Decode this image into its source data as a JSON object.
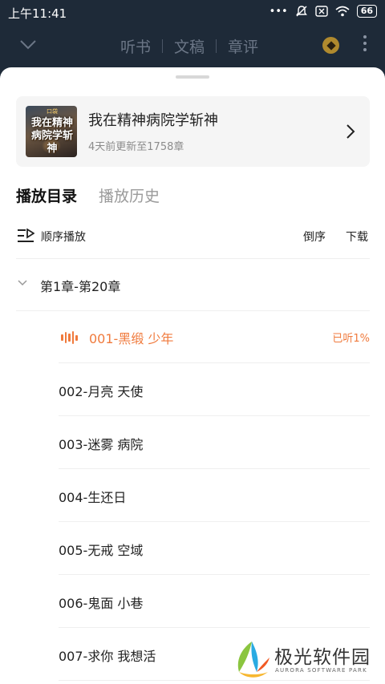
{
  "status_bar": {
    "time": "上午11:41",
    "signal_dots": "•••",
    "battery": "66"
  },
  "top_nav": {
    "tabs": [
      "听书",
      "文稿",
      "章评"
    ]
  },
  "book": {
    "title": "我在精神病院学斩神",
    "subtitle": "4天前更新至1758章",
    "cover_text": "我在精神病院学斩神",
    "cover_badge": "口袋"
  },
  "tabs": {
    "active": "播放目录",
    "inactive": "播放历史"
  },
  "toolbar": {
    "order_label": "顺序播放",
    "reverse_label": "倒序",
    "download_label": "下载"
  },
  "group": {
    "label": "第1章-第20章"
  },
  "chapters": [
    {
      "title": "001-黑缎 少年",
      "progress": "已听1%",
      "active": true
    },
    {
      "title": "002-月亮 天使"
    },
    {
      "title": "003-迷雾 病院"
    },
    {
      "title": "004-生还日"
    },
    {
      "title": "005-无戒 空域"
    },
    {
      "title": "006-鬼面 小巷"
    },
    {
      "title": "007-求你 我想活"
    }
  ],
  "watermark": {
    "name": "极光软件园",
    "sub": "AURORA SOFTWARE PARK"
  },
  "colors": {
    "accent": "#f07a3c",
    "header_bg": "#1e2a38",
    "card_bg": "#f5f5f5"
  }
}
